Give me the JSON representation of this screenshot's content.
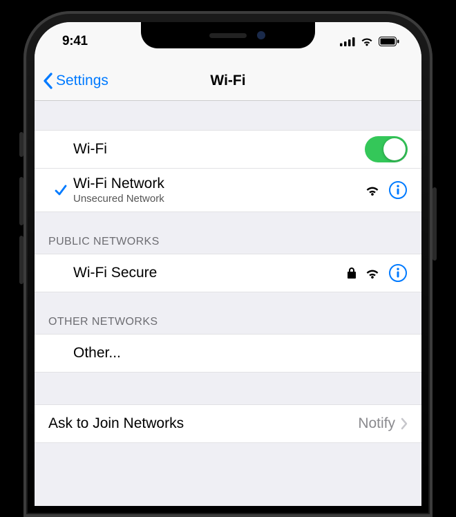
{
  "status": {
    "time": "9:41"
  },
  "nav": {
    "back": "Settings",
    "title": "Wi-Fi"
  },
  "wifi": {
    "toggle_label": "Wi-Fi",
    "connected": {
      "name": "Wi-Fi Network",
      "sub": "Unsecured Network"
    }
  },
  "sections": {
    "public_header": "PUBLIC NETWORKS",
    "public_network": "Wi-Fi Secure",
    "other_header": "OTHER NETWORKS",
    "other_label": "Other..."
  },
  "ask": {
    "label": "Ask to Join Networks",
    "value": "Notify"
  },
  "colors": {
    "blue": "#007AFF",
    "green": "#34C759"
  }
}
